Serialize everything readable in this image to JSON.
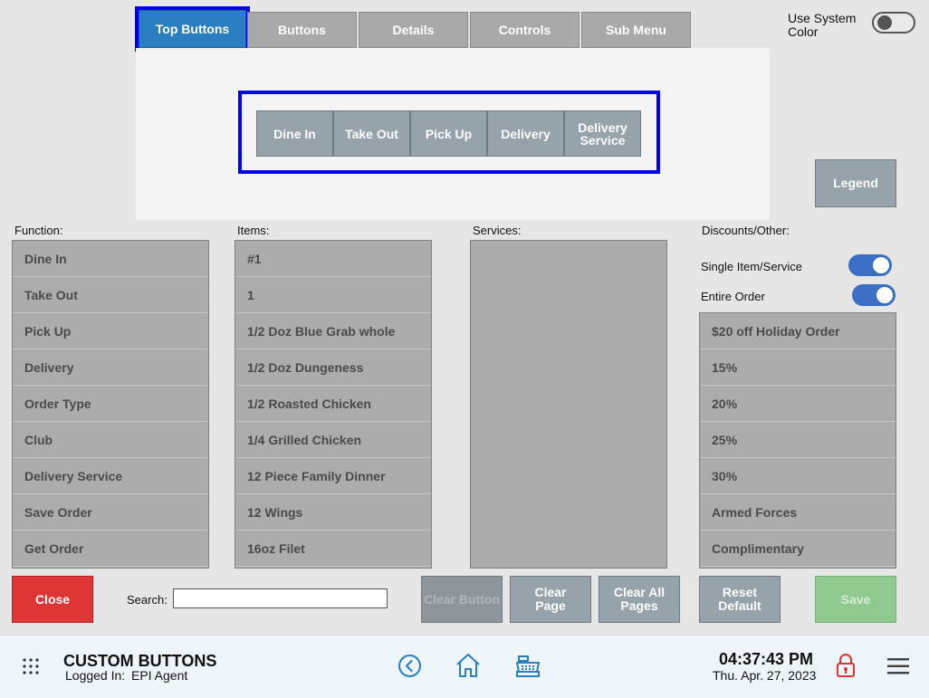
{
  "tabs": [
    "Top Buttons",
    "Buttons",
    "Details",
    "Controls",
    "Sub Menu"
  ],
  "system_color": {
    "label": "Use System Color",
    "enabled": false
  },
  "preview_buttons": [
    "Dine In",
    "Take Out",
    "Pick Up",
    "Delivery",
    "Delivery Service"
  ],
  "legend_label": "Legend",
  "function": {
    "label": "Function:",
    "items": [
      "Dine In",
      "Take Out",
      "Pick Up",
      "Delivery",
      "Order Type",
      "Club",
      "Delivery Service",
      "Save Order",
      "Get Order"
    ]
  },
  "items": {
    "label": "Items:",
    "items": [
      "#1",
      "1",
      "1/2 Doz Blue Grab whole",
      "1/2 Doz Dungeness",
      "1/2 Roasted Chicken",
      "1/4 Grilled Chicken",
      "12 Piece Family Dinner",
      "12 Wings",
      "16oz Filet"
    ]
  },
  "services": {
    "label": "Services:",
    "items": []
  },
  "discounts": {
    "label": "Discounts/Other:",
    "single_item_label": "Single Item/Service",
    "single_item_on": true,
    "entire_order_label": "Entire Order",
    "entire_order_on": true,
    "items": [
      "$20 off Holiday Order",
      "15%",
      "20%",
      "25%",
      "30%",
      "Armed Forces",
      "Complimentary"
    ]
  },
  "actions": {
    "close": "Close",
    "search_label": "Search:",
    "search_value": "",
    "clear_button": "Clear Button",
    "clear_page": "Clear Page",
    "clear_all_pages": "Clear All Pages",
    "reset_default": "Reset Default",
    "save": "Save"
  },
  "footer": {
    "title": "CUSTOM BUTTONS",
    "logged_in_label": "Logged In:",
    "user": "EPI Agent",
    "time": "04:37:43 PM",
    "date": "Thu. Apr. 27, 2023"
  },
  "colors": {
    "accent": "#2a7fc0",
    "selection": "#0000ee",
    "close": "#e03535",
    "save": "#8fc98f",
    "toggle_on": "#3b6fc6"
  }
}
